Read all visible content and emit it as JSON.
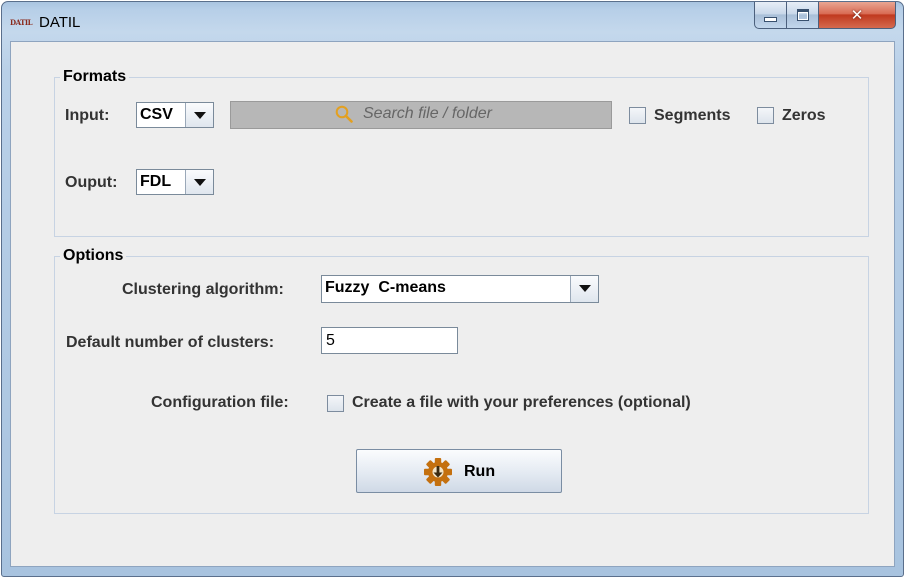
{
  "window": {
    "title": "DATIL",
    "icon_text": "DATIL",
    "close_glyph": "✕"
  },
  "formats": {
    "legend": "Formats",
    "input_label": "Input:",
    "input_format": "CSV",
    "search_placeholder": "Search file / folder",
    "segments_label": "Segments",
    "segments_checked": false,
    "zeros_label": "Zeros",
    "zeros_checked": false,
    "output_label": "Ouput:",
    "output_format": "FDL"
  },
  "options": {
    "legend": "Options",
    "clustering_label": "Clustering algorithm:",
    "clustering_value": "Fuzzy  C-means",
    "clusters_label": "Default number of clusters:",
    "clusters_value": "5",
    "config_label": "Configuration file:",
    "config_checkbox_label": "Create a file with your preferences (optional)",
    "config_checked": false
  },
  "run_button": {
    "label": "Run"
  },
  "colors": {
    "window_frame": "#b7cfe8",
    "client_bg": "#eeeeee",
    "group_border": "#c7d3e3",
    "close_button": "#c0391f",
    "gear_icon": "#c4700f",
    "search_icon": "#e3a020"
  }
}
